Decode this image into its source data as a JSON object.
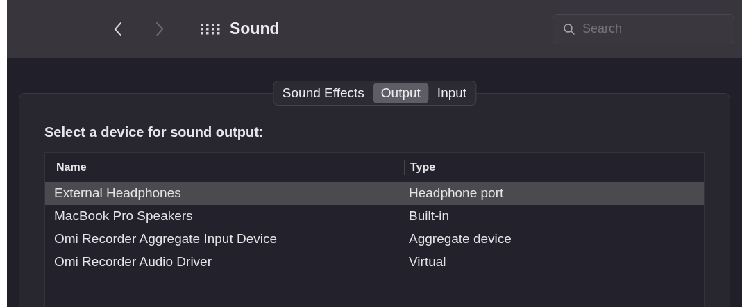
{
  "window": {
    "title": "Sound"
  },
  "search": {
    "placeholder": "Search"
  },
  "tabs": [
    {
      "label": "Sound Effects",
      "selected": false
    },
    {
      "label": "Output",
      "selected": true
    },
    {
      "label": "Input",
      "selected": false
    }
  ],
  "prompt": "Select a device for sound output:",
  "table": {
    "columns": [
      "Name",
      "Type"
    ],
    "rows": [
      {
        "name": "External Headphones",
        "type": "Headphone port",
        "selected": true
      },
      {
        "name": "MacBook Pro Speakers",
        "type": "Built-in",
        "selected": false
      },
      {
        "name": "Omi Recorder Aggregate Input Device",
        "type": "Aggregate device",
        "selected": false
      },
      {
        "name": "Omi Recorder Audio Driver",
        "type": "Virtual",
        "selected": false
      }
    ]
  }
}
